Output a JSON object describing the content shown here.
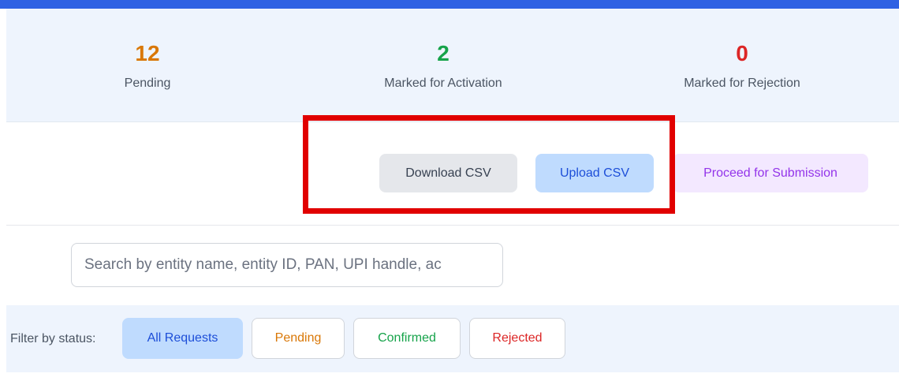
{
  "stats": {
    "pending": {
      "value": "12",
      "label": "Pending",
      "color": "#d97706"
    },
    "activation": {
      "value": "2",
      "label": "Marked for Activation",
      "color": "#16a34a"
    },
    "rejection": {
      "value": "0",
      "label": "Marked for Rejection",
      "color": "#dc2626"
    }
  },
  "actions": {
    "download_label": "Download CSV",
    "upload_label": "Upload CSV",
    "submit_label": "Proceed for Submission"
  },
  "search": {
    "placeholder": "Search by entity name, entity ID, PAN, UPI handle, ac",
    "value": ""
  },
  "filter": {
    "label": "Filter by status:",
    "options": [
      "All Requests",
      "Pending",
      "Confirmed",
      "Rejected"
    ],
    "selected": "All Requests"
  },
  "colors": {
    "accent_bar": "#2f62e3",
    "highlight_box": "#e10000"
  }
}
